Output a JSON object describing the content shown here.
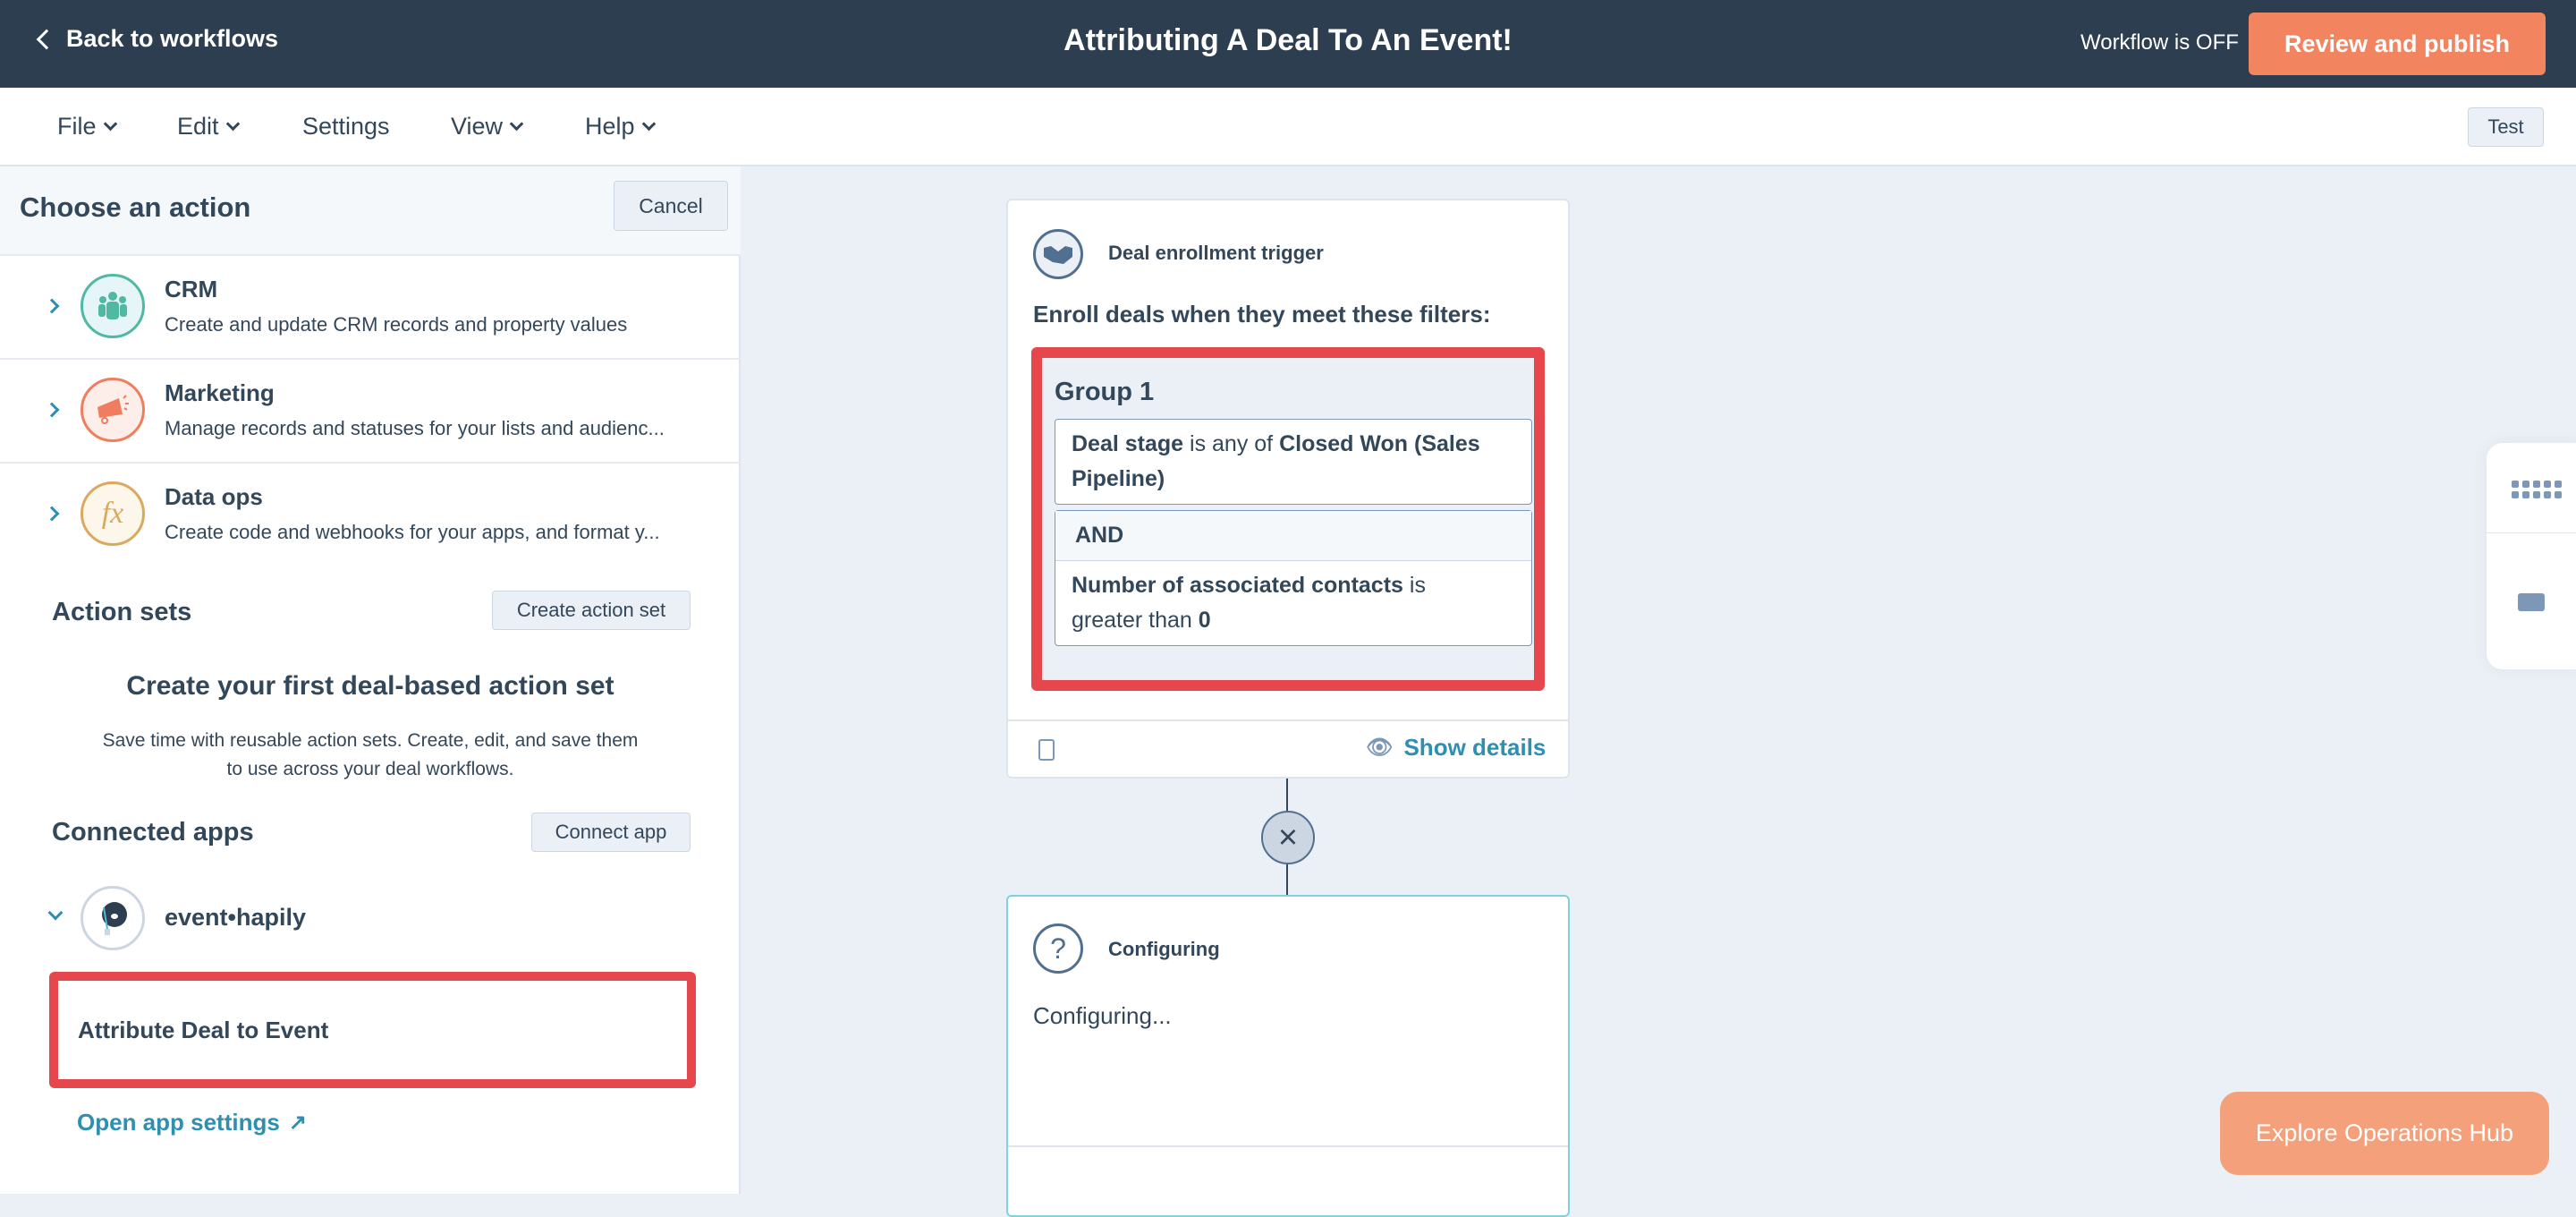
{
  "topbar": {
    "back": "Back to workflows",
    "title": "Attributing A Deal To An Event!",
    "status": "Workflow is OFF",
    "publish": "Review and publish"
  },
  "menu": {
    "file": "File",
    "edit": "Edit",
    "settings": "Settings",
    "view": "View",
    "help": "Help",
    "test": "Test"
  },
  "panel": {
    "title": "Choose an action",
    "cancel": "Cancel",
    "categories": [
      {
        "name": "CRM",
        "desc": "Create and update CRM records and property values",
        "icon": "people-icon",
        "color": "#4fb9a1"
      },
      {
        "name": "Marketing",
        "desc": "Manage records and statuses for your lists and audienc...",
        "icon": "megaphone-icon",
        "color": "#ef7d5e"
      },
      {
        "name": "Data ops",
        "desc": "Create code and webhooks for your apps, and format y...",
        "icon": "fx-icon",
        "color": "#d9aa5e",
        "glyph": "fx"
      }
    ],
    "action_sets": {
      "title": "Action sets",
      "button": "Create action set",
      "empty_title": "Create your first deal-based action set",
      "empty_desc1": "Save time with reusable action sets. Create, edit, and save them",
      "empty_desc2": "to use across your deal workflows."
    },
    "connected": {
      "title": "Connected apps",
      "button": "Connect app",
      "app": "event•hapily",
      "action": "Attribute Deal to Event",
      "settings": "Open app settings"
    }
  },
  "trigger": {
    "title": "Deal enrollment trigger",
    "subtitle": "Enroll deals when they meet these filters:",
    "group": "Group 1",
    "filter1": {
      "prop": "Deal stage",
      "op": "is any of",
      "val": "Closed Won (Sales Pipeline)"
    },
    "and": "AND",
    "filter2": {
      "prop": "Number of associated contacts",
      "op": "is",
      "op2": "greater than",
      "val": "0"
    },
    "show_details": "Show details"
  },
  "config": {
    "title": "Configuring",
    "body": "Configuring...",
    "icon_glyph": "?"
  },
  "explore": "Explore Operations Hub",
  "colors": {
    "accent": "#f2845f",
    "highlight": "#e5474d",
    "link": "#2e8fb0",
    "topbar": "#2d3e50"
  }
}
